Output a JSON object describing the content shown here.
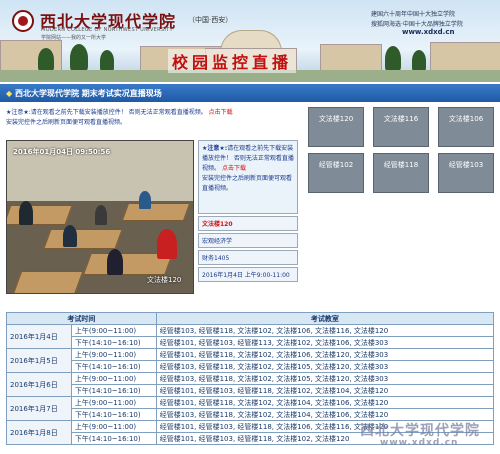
{
  "header": {
    "school_name": "西北大学现代学院",
    "location": "（中国·西安）",
    "school_en": "MODERN COLLEGE OF NORTHWEST UNIVERSITY",
    "slogan": "学院网站——我的又一所大学",
    "right_line1": "建国六十周年中国十大独立学院",
    "right_line2": "搜狐网海选·中国十大品牌独立学院",
    "url": "www.xdxd.cn",
    "title": "校园监控直播"
  },
  "bar": {
    "bullet": "◆",
    "title": "西北大学现代学院  期末考试实况直播现场"
  },
  "notice": {
    "prefix": "★注意★:请在观看之前先下载安装播放控件！ 否则无法正常观看直播视频。",
    "link": "点击下载",
    "line2": "安装完控件之后刷新页面便可观看直播视频。"
  },
  "video": {
    "timestamp": "2016年01月04日   09:50:56",
    "camera": "文法楼120"
  },
  "side": {
    "notice_star": "★注意★:",
    "notice_body": "请在观看之前先下载安装播放控件！ 否则无法正常观看直播视频。",
    "notice_link": "点击下载",
    "notice_tail": "安装完控件之后刷新页面便可观看直播视频。",
    "room": "文法楼120",
    "subject": "宏观经济学",
    "class": "财务1405",
    "time": "2016年1月4日 上午9:00-11:00"
  },
  "rooms": [
    "文法楼120",
    "文法楼116",
    "文法楼106",
    "经管楼102",
    "经管楼118",
    "经管楼103"
  ],
  "schedule": {
    "headers": [
      "考试时间",
      "考试教室"
    ],
    "rows": [
      {
        "date": "2016年1月4日",
        "slot": "上午(9:00~11:00)",
        "rooms": "经管楼103, 经管楼118, 文法楼102, 文法楼106, 文法楼116, 文法楼120"
      },
      {
        "date": "",
        "slot": "下午(14:10~16:10)",
        "rooms": "经管楼101, 经管楼103, 经管楼113, 文法楼102, 文法楼106, 文法楼303"
      },
      {
        "date": "2016年1月5日",
        "slot": "上午(9:00~11:00)",
        "rooms": "经管楼101, 经管楼118, 文法楼102, 文法楼106, 文法楼120, 文法楼303"
      },
      {
        "date": "",
        "slot": "下午(14:10~16:10)",
        "rooms": "经管楼103, 经管楼118, 文法楼102, 文法楼105, 文法楼120, 文法楼303"
      },
      {
        "date": "2016年1月6日",
        "slot": "上午(9:00~11:00)",
        "rooms": "经管楼103, 经管楼118, 文法楼102, 文法楼105, 文法楼120, 文法楼303"
      },
      {
        "date": "",
        "slot": "下午(14:10~16:10)",
        "rooms": "经管楼101, 经管楼103, 经管楼118, 文法楼102, 文法楼104, 文法楼120"
      },
      {
        "date": "2016年1月7日",
        "slot": "上午(9:00~11:00)",
        "rooms": "经管楼101, 经管楼118, 文法楼102, 文法楼104, 文法楼106, 文法楼120"
      },
      {
        "date": "",
        "slot": "下午(14:10~16:10)",
        "rooms": "经管楼103, 经管楼118, 文法楼102, 文法楼104, 文法楼106, 文法楼120"
      },
      {
        "date": "2016年1月8日",
        "slot": "上午(9:00~11:00)",
        "rooms": "经管楼101, 经管楼103, 经管楼118, 文法楼106, 文法楼116, 文法楼120"
      },
      {
        "date": "",
        "slot": "下午(14:10~16:10)",
        "rooms": "经管楼101, 经管楼103, 经管楼118, 文法楼102, 文法楼120"
      }
    ]
  },
  "watermark": {
    "line1": "西北大学现代学院",
    "line2": "www.xdxd.cn"
  }
}
